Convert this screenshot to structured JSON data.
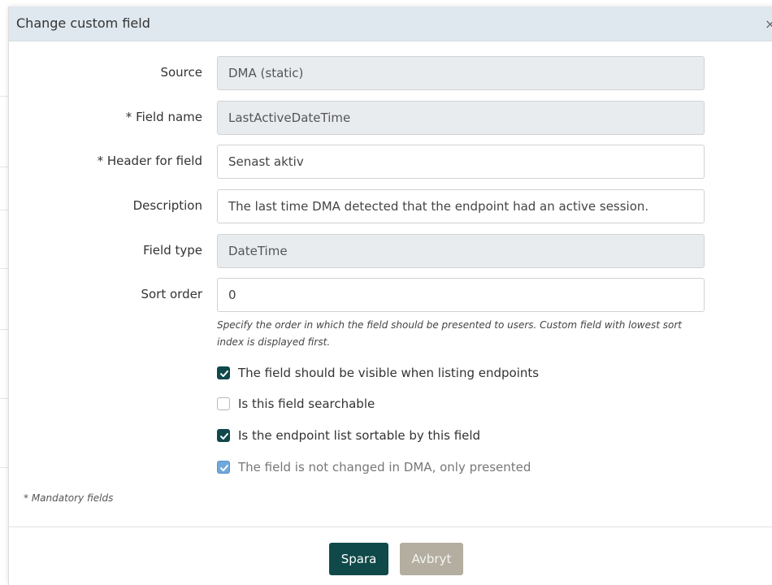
{
  "dialog": {
    "title": "Change custom field",
    "close_glyph": "×"
  },
  "fields": {
    "source": {
      "label": "Source",
      "value": "DMA (static)",
      "readonly": true
    },
    "field_name": {
      "label": "* Field name",
      "value": "LastActiveDateTime",
      "readonly": true
    },
    "header": {
      "label": "* Header for field",
      "value": "Senast aktiv",
      "readonly": false
    },
    "description": {
      "label": "Description",
      "value": "The last time DMA detected that the endpoint had an active session.",
      "readonly": false
    },
    "field_type": {
      "label": "Field type",
      "value": "DateTime",
      "readonly": true
    },
    "sort_order": {
      "label": "Sort order",
      "value": "0",
      "readonly": false
    }
  },
  "sort_help": "Specify the order in which the field should be presented to users. Custom field with lowest sort index is displayed first.",
  "checkboxes": [
    {
      "label": "The field should be visible when listing endpoints",
      "checked": true,
      "disabled": false
    },
    {
      "label": "Is this field searchable",
      "checked": false,
      "disabled": false
    },
    {
      "label": "Is the endpoint list sortable by this field",
      "checked": true,
      "disabled": false
    },
    {
      "label": "The field is not changed in DMA, only presented",
      "checked": true,
      "disabled": true
    }
  ],
  "mandatory_note": "* Mandatory fields",
  "buttons": {
    "save": "Spara",
    "cancel": "Avbryt"
  },
  "colors": {
    "primary": "#10494a",
    "secondary": "#b3aea0",
    "header_bg": "#dfe8ef",
    "readonly_bg": "#e9ecef",
    "disabled_check": "#6fa8dc"
  },
  "icons": {
    "close": "close-icon",
    "check": "checkmark-icon"
  }
}
